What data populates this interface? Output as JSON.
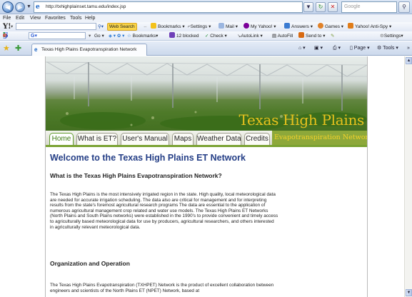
{
  "browser": {
    "url": "http://txhighplainset.tamu.edu/index.jsp",
    "search_placeholder": "Google",
    "menu": [
      "File",
      "Edit",
      "View",
      "Favorites",
      "Tools",
      "Help"
    ],
    "yahoo_toolbar": {
      "web_search": "Web Search",
      "bookmarks": "Bookmarks",
      "settings": "Settings",
      "mail": "Mail",
      "my_yahoo": "My Yahoo!",
      "answers": "Answers",
      "games": "Games",
      "antispy": "Yahoo! Anti-Spy"
    },
    "google_toolbar": {
      "go": "Go",
      "bookmarks": "Bookmarks",
      "blocked": "12 blocked",
      "check": "Check",
      "autolink": "AutoLink",
      "autofill": "AutoFill",
      "send_to": "Send to",
      "settings": "Settings"
    },
    "tab_title": "Texas High Plains Evapotranspiration Network",
    "commands": {
      "page": "Page",
      "tools": "Tools"
    }
  },
  "site": {
    "banner_title": "Texas High Plains",
    "subtitle": "Evapotranspiration Network",
    "nav": [
      "Home",
      "What is ET?",
      "User's Manual",
      "Maps",
      "Weather Data",
      "Credits"
    ],
    "heading": "Welcome to the Texas High Plains ET Network",
    "section1_title": "What is the Texas High Plains Evapotranspiration Network?",
    "paragraph1": "The Texas High Plains is the most intensively irrigated region in the state. High quality, local meteorological data are needed for accurate irrigation scheduling. The data also are critical for management and for interpreting results from the state's foremost agricultural research programs The data are essential to the application of numerous agricultural management crop related and water use models. The Texas High Plains ET Networks (North Plains and South Plains networks) were established in the 1990's to provide convenient and timely access to agriculturally based meteorological data for use by producers, agricultural researchers, and others interested in agriculturally relevant meteorological data.",
    "section2_title": "Organization and Operation",
    "paragraph2": "The Texas High Plains Evapotranspiration (TXHPET) Network is the product of excellent collaboration between engineers and scientists of the North Plains ET (NPET) Network, based at"
  }
}
